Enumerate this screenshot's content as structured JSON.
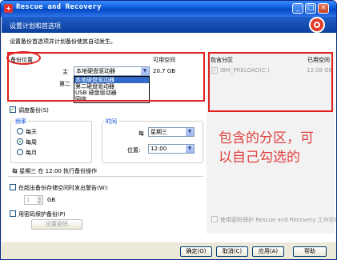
{
  "window": {
    "title": "Rescue and Recovery",
    "min": "_",
    "max": "□",
    "close": "×"
  },
  "header": {
    "title": "设置计划和首选项"
  },
  "intro": "设置备份首选项并计划备份使其自动发生。",
  "backup": {
    "location_label": "备份位置",
    "primary_label": "主",
    "secondary_label": "第二",
    "primary_value": "本地硬盘驱动器",
    "available_space_label": "可用空间",
    "available_space_value": "20.7 GB",
    "dropdown_options": [
      "本地硬盘驱动器",
      "第二硬盘驱动器",
      "USB 硬盘驱动器",
      "网络"
    ]
  },
  "partitions": {
    "title": "包含分区",
    "space_label": "已用空间",
    "items": [
      {
        "name": "IBM_PRELOAD(C:)",
        "used": "12.08 GB"
      }
    ]
  },
  "schedule": {
    "label": "调度备份(S)",
    "frequency_label": "频率",
    "freq_options": [
      "每天",
      "每周",
      "每月"
    ],
    "time_label": "时间",
    "day_prefix": "每",
    "day_value": "星期三",
    "position_label": "位置:",
    "time_value": "12:00",
    "summary": "每 星期三 在 12:00 执行备份操作"
  },
  "options": {
    "warn_label": "在超出备份存储空间时发出警告(W):",
    "warn_value": "1",
    "warn_unit": "GB",
    "password_label": "用密码保护备份(P)",
    "set_password": "设置密码",
    "rr_password_label": "使用密码保护 Rescue and Recovery 工作空间"
  },
  "annotation": {
    "line1": "包含的分区，可",
    "line2": "以自己勾选的"
  },
  "buttons": {
    "ok": "确定(O)",
    "cancel": "取消(C)",
    "apply": "应用(A)",
    "help": "帮助"
  },
  "icons": {
    "check": "✓",
    "arrow": "▼",
    "spin_up": "▲",
    "spin_down": "▼"
  }
}
